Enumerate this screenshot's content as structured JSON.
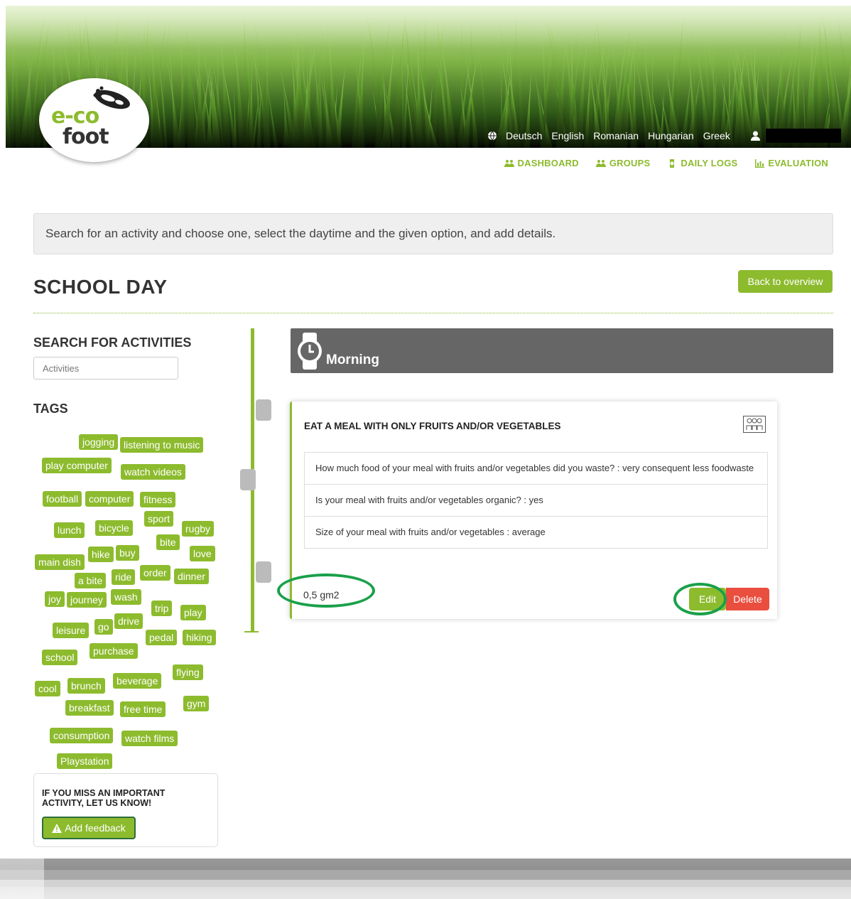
{
  "header": {
    "logo_line1": "e-co",
    "logo_line2": "foot",
    "languages": [
      "Deutsch",
      "English",
      "Romanian",
      "Hungarian",
      "Greek"
    ],
    "nav": [
      {
        "label": "DASHBOARD",
        "icon": "people-icon"
      },
      {
        "label": "GROUPS",
        "icon": "people-icon"
      },
      {
        "label": "DAILY LOGS",
        "icon": "watch-icon"
      },
      {
        "label": "EVALUATION",
        "icon": "bar-chart-icon"
      }
    ]
  },
  "info_text": "Search for an activity and choose one, select the daytime and the given option, and add details.",
  "page_title": "SCHOOL DAY",
  "back_label": "Back to overview",
  "sidebar": {
    "search_title": "SEARCH FOR ACTIVITIES",
    "search_placeholder": "Activities",
    "tags_title": "TAGS",
    "tags": [
      "jogging",
      "listening to music",
      "play computer",
      "watch videos",
      "football",
      "computer",
      "fitness",
      "sport",
      "lunch",
      "bicycle",
      "rugby",
      "bite",
      "hike",
      "buy",
      "love",
      "main dish",
      "a bite",
      "ride",
      "order",
      "dinner",
      "joy",
      "journey",
      "wash",
      "trip",
      "play",
      "leisure",
      "go",
      "drive",
      "pedal",
      "hiking",
      "school",
      "purchase",
      "flying",
      "cool",
      "brunch",
      "beverage",
      "breakfast",
      "free time",
      "gym",
      "consumption",
      "watch films",
      "Playstation"
    ],
    "feedback_title": "IF YOU MISS AN IMPORTANT ACTIVITY, LET US KNOW!",
    "feedback_button": "Add feedback"
  },
  "timeline": {
    "section_title": "Morning",
    "activity": {
      "title": "EAT A MEAL WITH ONLY FRUITS AND/OR VEGETABLES",
      "details": [
        "How much food of your meal with fruits and/or vegetables did you waste? : very consequent less foodwaste",
        "Is your meal with fruits and/or vegetables organic? : yes",
        "Size of your meal with fruits and/or vegetables : average"
      ],
      "footprint": "0,5 gm2",
      "edit_label": "Edit",
      "delete_label": "Delete"
    }
  },
  "colors": {
    "accent": "#8dbb2e",
    "danger": "#e94e3f",
    "highlight_ring": "#1aa04a",
    "section_header": "#666666"
  }
}
